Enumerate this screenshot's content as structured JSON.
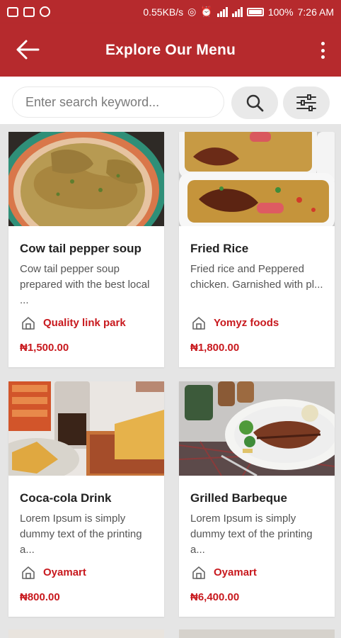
{
  "status_bar": {
    "speed": "0.55KB/s",
    "battery": "100%",
    "time": "7:26 AM"
  },
  "header": {
    "title": "Explore Our Menu",
    "back_icon": "arrow-left-icon",
    "menu_icon": "more-vertical-icon"
  },
  "search": {
    "placeholder": "Enter search keyword...",
    "search_icon": "search-icon",
    "filter_icon": "sliders-icon"
  },
  "items": [
    {
      "name": "Cow tail pepper soup",
      "description": "Cow tail pepper soup prepared with the best local ...",
      "store": "Quality link park",
      "price": "₦1,500.00"
    },
    {
      "name": "Fried Rice",
      "description": "Fried rice and Peppered chicken. Garnished with pl...",
      "store": "Yomyz foods",
      "price": "₦1,800.00"
    },
    {
      "name": "Coca-cola Drink",
      "description": "Lorem Ipsum is simply dummy text of the printing a...",
      "store": "Oyamart",
      "price": "₦800.00"
    },
    {
      "name": "Grilled Barbeque",
      "description": "Lorem Ipsum is simply dummy text of the printing a...",
      "store": "Oyamart",
      "price": "₦6,400.00"
    }
  ],
  "colors": {
    "primary": "#b62a2d",
    "price_red": "#c8191e",
    "background": "#e5e5e5"
  }
}
